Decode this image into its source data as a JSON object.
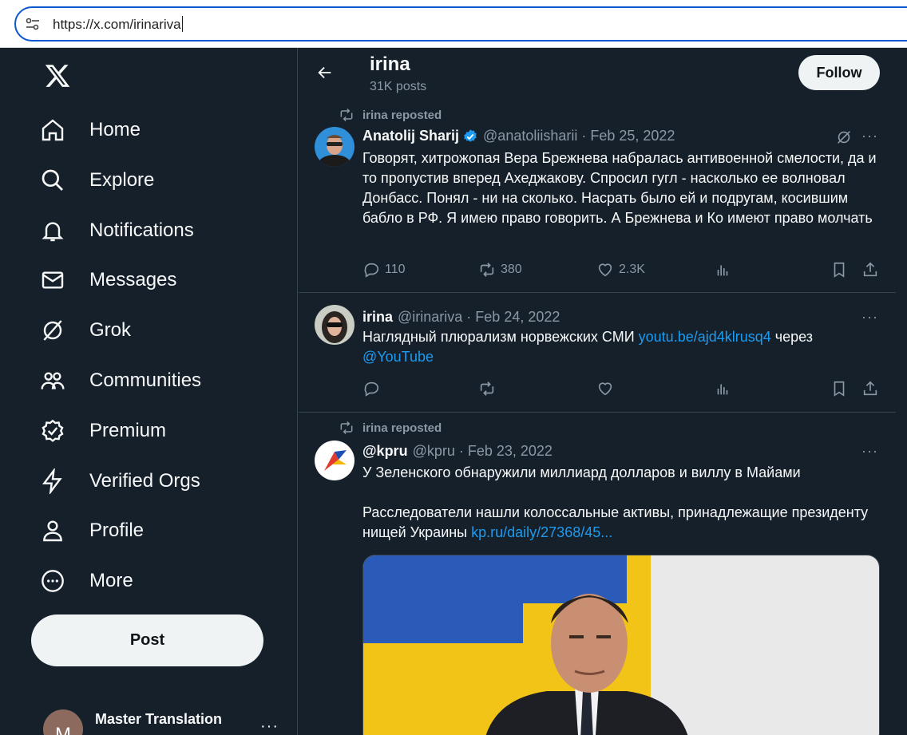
{
  "browser": {
    "url": "https://x.com/irinariva"
  },
  "sidebar": {
    "items": [
      {
        "label": "Home",
        "icon": "home-icon"
      },
      {
        "label": "Explore",
        "icon": "search-icon"
      },
      {
        "label": "Notifications",
        "icon": "bell-icon"
      },
      {
        "label": "Messages",
        "icon": "envelope-icon"
      },
      {
        "label": "Grok",
        "icon": "grok-icon"
      },
      {
        "label": "Communities",
        "icon": "communities-icon"
      },
      {
        "label": "Premium",
        "icon": "premium-icon"
      },
      {
        "label": "Verified Orgs",
        "icon": "lightning-icon"
      },
      {
        "label": "Profile",
        "icon": "person-icon"
      },
      {
        "label": "More",
        "icon": "more-circle-icon"
      }
    ],
    "post_label": "Post",
    "account": {
      "name": "Master Translation",
      "avatar_letter": "M",
      "more": "···"
    }
  },
  "header": {
    "name": "irina",
    "posts": "31K posts",
    "follow_label": "Follow"
  },
  "tweets": [
    {
      "repost": "irina reposted",
      "name": "Anatolij Sharij",
      "handle_date": "@anatoliisharii · Feb 25, 2022",
      "text": "Говорят, хитрожопая Вера Брежнева набралась антивоенной смелости, да и то пропустив вперед Ахеджакову. Спросил гугл - насколько ее волновал Донбасс. Понял - ни на сколько. Насрать было ей и подругам, косившим бабло в РФ. Я имею право говорить. А Брежнева и Ко имеют право молчать",
      "replies": "110",
      "reposts": "380",
      "likes": "2.3K"
    },
    {
      "name": "irina",
      "handle_date": "@irinariva · Feb 24, 2022",
      "text_before": "Наглядный плюрализм норвежских СМИ ",
      "link1": "youtu.be/ajd4klrusq4",
      "text_middle": " через ",
      "link2": "@YouTube"
    },
    {
      "repost": "irina reposted",
      "name": "@kpru",
      "handle_date": "@kpru · Feb 23, 2022",
      "text1": "У Зеленского обнаружили миллиард долларов и виллу в Майами",
      "text2": "Расследователи нашли колоссальные активы, принадлежащие президенту нищей Украины ",
      "link": "kp.ru/daily/27368/45..."
    }
  ],
  "more_dots": "···",
  "colors": {
    "background": "#15202b",
    "accent": "#1d9bf0",
    "muted": "#8b98a5",
    "border": "#38444d"
  }
}
